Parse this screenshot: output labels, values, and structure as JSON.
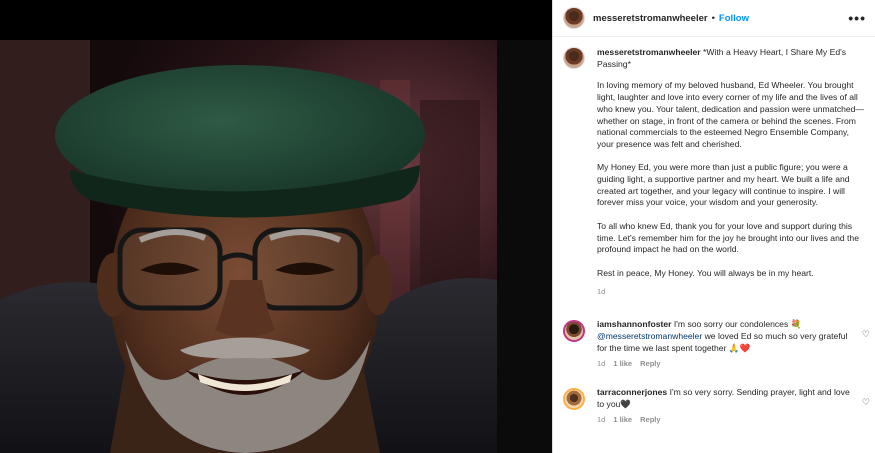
{
  "header": {
    "username": "messeretstromanwheeler",
    "separator": "•",
    "follow_label": "Follow",
    "more_label": "•••"
  },
  "post": {
    "username": "messeretstromanwheeler",
    "title": "*With a Heavy Heart, I Share My Ed's Passing*",
    "paragraphs": [
      "In loving memory of my beloved husband, Ed Wheeler. You brought light, laughter and love into every corner of my life and the lives of all who knew you. Your talent, dedication and passion were unmatched—whether on stage, in front of the camera or behind the scenes. From national commercials to the esteemed Negro Ensemble Company, your presence was felt and cherished.",
      "My Honey Ed, you were more than just a public figure; you were a guiding light, a supportive partner and my heart. We built a life and created art together, and your legacy will continue to inspire. I will forever miss your voice, your wisdom and your generosity.",
      "To all who knew Ed, thank you for your love and support during this time. Let's remember him for the joy he brought into our lives and the profound impact he had on the world.",
      "Rest in peace, My Honey. You will always be in my heart."
    ],
    "time": "1d"
  },
  "comments": [
    {
      "username": "iamshannonfoster",
      "text_before": " I'm soo sorry our condolences 💐 ",
      "mention": "@messeretstromanwheeler",
      "text_after": " we loved Ed so much so very grateful for the time we last spent together 🙏❤️",
      "time": "1d",
      "likes": "1 like",
      "reply": "Reply",
      "heart": "♡"
    },
    {
      "username": "tarraconnerjones",
      "text_before": " I'm so very sorry. Sending prayer, light and love to you🖤",
      "mention": "",
      "text_after": "",
      "time": "1d",
      "likes": "1 like",
      "reply": "Reply",
      "heart": "♡"
    }
  ]
}
